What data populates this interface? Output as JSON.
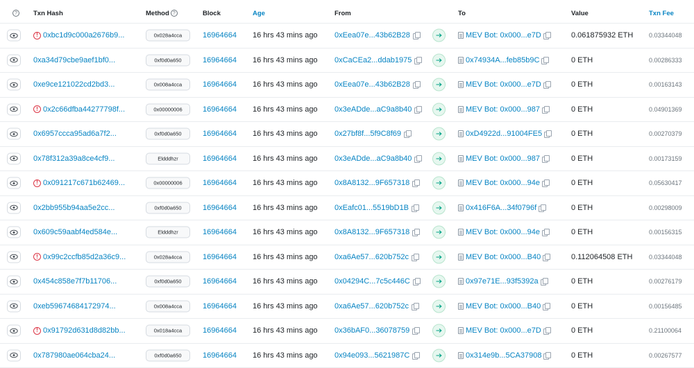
{
  "header": {
    "help_glyph": "?",
    "txn_hash": "Txn Hash",
    "method": "Method",
    "block": "Block",
    "age": "Age",
    "from": "From",
    "to": "To",
    "value": "Value",
    "txn_fee": "Txn Fee"
  },
  "colors": {
    "link": "#0784c3",
    "error": "#dc3545",
    "arrow_bg": "#e6f7ef",
    "arrow_fg": "#00a186"
  },
  "rows": [
    {
      "hash": "0xbc1d9c000a2676b9...",
      "error": true,
      "method": "0x028a4cca",
      "block": "16964664",
      "age": "16 hrs 43 mins ago",
      "from": "0xEea07e...43b62B28",
      "to": "MEV Bot: 0x000...e7D",
      "to_contract": true,
      "value": "0.061875932 ETH",
      "fee": "0.03344048"
    },
    {
      "hash": "0xa34d79cbe9aef1bf0...",
      "error": false,
      "method": "0xf0d0a650",
      "block": "16964664",
      "age": "16 hrs 43 mins ago",
      "from": "0xCaCEa2...ddab1975",
      "to": "0x74934A...feb85b9C",
      "to_contract": true,
      "value": "0 ETH",
      "fee": "0.00286333"
    },
    {
      "hash": "0xe9ce121022cd2bd3...",
      "error": false,
      "method": "0x008a4cca",
      "block": "16964664",
      "age": "16 hrs 43 mins ago",
      "from": "0xEea07e...43b62B28",
      "to": "MEV Bot: 0x000...e7D",
      "to_contract": true,
      "value": "0 ETH",
      "fee": "0.00163143"
    },
    {
      "hash": "0x2c66dfba44277798f...",
      "error": true,
      "method": "0x00000006",
      "block": "16964664",
      "age": "16 hrs 43 mins ago",
      "from": "0x3eADde...aC9a8b40",
      "to": "MEV Bot: 0x000...987",
      "to_contract": true,
      "value": "0 ETH",
      "fee": "0.04901369"
    },
    {
      "hash": "0x6957ccca95ad6a7f2...",
      "error": false,
      "method": "0xf0d0a650",
      "block": "16964664",
      "age": "16 hrs 43 mins ago",
      "from": "0x27bf8f...5f9C8f69",
      "to": "0xD4922d...91004FE5",
      "to_contract": true,
      "value": "0 ETH",
      "fee": "0.00270379"
    },
    {
      "hash": "0x78f312a39a8ce4cf9...",
      "error": false,
      "method": "Eldddhzr",
      "block": "16964664",
      "age": "16 hrs 43 mins ago",
      "from": "0x3eADde...aC9a8b40",
      "to": "MEV Bot: 0x000...987",
      "to_contract": true,
      "value": "0 ETH",
      "fee": "0.00173159"
    },
    {
      "hash": "0x091217c671b62469...",
      "error": true,
      "method": "0x00000006",
      "block": "16964664",
      "age": "16 hrs 43 mins ago",
      "from": "0x8A8132...9F657318",
      "to": "MEV Bot: 0x000...94e",
      "to_contract": true,
      "value": "0 ETH",
      "fee": "0.05630417"
    },
    {
      "hash": "0x2bb955b94aa5e2cc...",
      "error": false,
      "method": "0xf0d0a650",
      "block": "16964664",
      "age": "16 hrs 43 mins ago",
      "from": "0xEafc01...5519bD1B",
      "to": "0x416F6A...34f0796f",
      "to_contract": true,
      "value": "0 ETH",
      "fee": "0.00298009"
    },
    {
      "hash": "0x609c59aabf4ed584e...",
      "error": false,
      "method": "Eldddhzr",
      "block": "16964664",
      "age": "16 hrs 43 mins ago",
      "from": "0x8A8132...9F657318",
      "to": "MEV Bot: 0x000...94e",
      "to_contract": true,
      "value": "0 ETH",
      "fee": "0.00156315"
    },
    {
      "hash": "0x99c2ccfb85d2a36c9...",
      "error": true,
      "method": "0x028a4cca",
      "block": "16964664",
      "age": "16 hrs 43 mins ago",
      "from": "0xa6Ae57...620b752c",
      "to": "MEV Bot: 0x000...B40",
      "to_contract": true,
      "value": "0.112064508 ETH",
      "fee": "0.03344048"
    },
    {
      "hash": "0x454c858e7f7b11706...",
      "error": false,
      "method": "0xf0d0a650",
      "block": "16964664",
      "age": "16 hrs 43 mins ago",
      "from": "0x04294C...7c5c446C",
      "to": "0x97e71E...93f5392a",
      "to_contract": true,
      "value": "0 ETH",
      "fee": "0.00276179"
    },
    {
      "hash": "0xeb59674684172974...",
      "error": false,
      "method": "0x008a4cca",
      "block": "16964664",
      "age": "16 hrs 43 mins ago",
      "from": "0xa6Ae57...620b752c",
      "to": "MEV Bot: 0x000...B40",
      "to_contract": true,
      "value": "0 ETH",
      "fee": "0.00156485"
    },
    {
      "hash": "0x91792d631d8d82bb...",
      "error": true,
      "method": "0x018a4cca",
      "block": "16964664",
      "age": "16 hrs 43 mins ago",
      "from": "0x36bAF0...36078759",
      "to": "MEV Bot: 0x000...e7D",
      "to_contract": true,
      "value": "0 ETH",
      "fee": "0.21100064"
    },
    {
      "hash": "0x787980ae064cba24...",
      "error": false,
      "method": "0xf0d0a650",
      "block": "16964664",
      "age": "16 hrs 43 mins ago",
      "from": "0x94e093...5621987C",
      "to": "0x314e9b...5CA37908",
      "to_contract": true,
      "value": "0 ETH",
      "fee": "0.00267577"
    }
  ]
}
